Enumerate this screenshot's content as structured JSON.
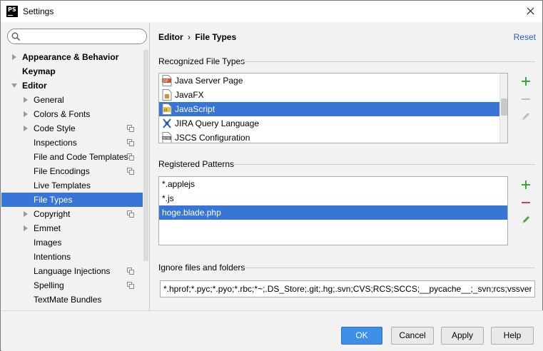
{
  "window": {
    "title": "Settings",
    "app_icon": "PS"
  },
  "search": {
    "placeholder": "",
    "value": ""
  },
  "sidebar": {
    "items": [
      {
        "label": "Appearance & Behavior",
        "level": 0,
        "arrow": "right",
        "bold": true
      },
      {
        "label": "Keymap",
        "level": 0,
        "arrow": "none",
        "bold": true
      },
      {
        "label": "Editor",
        "level": 0,
        "arrow": "down",
        "bold": true
      },
      {
        "label": "General",
        "level": 1,
        "arrow": "right"
      },
      {
        "label": "Colors & Fonts",
        "level": 1,
        "arrow": "right"
      },
      {
        "label": "Code Style",
        "level": 1,
        "arrow": "right",
        "copy": true
      },
      {
        "label": "Inspections",
        "level": 1,
        "arrow": "none",
        "copy": true
      },
      {
        "label": "File and Code Templates",
        "level": 1,
        "arrow": "none",
        "copy": true
      },
      {
        "label": "File Encodings",
        "level": 1,
        "arrow": "none",
        "copy": true
      },
      {
        "label": "Live Templates",
        "level": 1,
        "arrow": "none"
      },
      {
        "label": "File Types",
        "level": 1,
        "arrow": "none",
        "selected": true
      },
      {
        "label": "Copyright",
        "level": 1,
        "arrow": "right",
        "copy": true
      },
      {
        "label": "Emmet",
        "level": 1,
        "arrow": "right"
      },
      {
        "label": "Images",
        "level": 1,
        "arrow": "none"
      },
      {
        "label": "Intentions",
        "level": 1,
        "arrow": "none"
      },
      {
        "label": "Language Injections",
        "level": 1,
        "arrow": "none",
        "copy": true
      },
      {
        "label": "Spelling",
        "level": 1,
        "arrow": "none",
        "copy": true
      },
      {
        "label": "TextMate Bundles",
        "level": 1,
        "arrow": "none"
      }
    ]
  },
  "main": {
    "breadcrumb": {
      "parent": "Editor",
      "separator": "›",
      "current": "File Types"
    },
    "reset_label": "Reset",
    "recognized": {
      "label": "Recognized File Types",
      "items": [
        {
          "label": "Java Server Page",
          "icon": "jsp-file-icon"
        },
        {
          "label": "JavaFX",
          "icon": "javafx-file-icon"
        },
        {
          "label": "JavaScript",
          "icon": "js-file-icon",
          "selected": true
        },
        {
          "label": "JIRA Query Language",
          "icon": "jira-icon"
        },
        {
          "label": "JSCS Configuration",
          "icon": "json-file-icon"
        }
      ]
    },
    "patterns": {
      "label": "Registered Patterns",
      "items": [
        {
          "label": "*.applejs"
        },
        {
          "label": "*.js"
        },
        {
          "label": "hoge.blade.php",
          "selected": true
        }
      ]
    },
    "ignore": {
      "label": "Ignore files and folders",
      "value": "*.hprof;*.pyc;*.pyo;*.rbc;*~;.DS_Store;.git;.hg;.svn;CVS;RCS;SCCS;__pycache__;_svn;rcs;vssver.scc;vs"
    }
  },
  "buttons": {
    "ok": "OK",
    "cancel": "Cancel",
    "apply": "Apply",
    "help": "Help"
  },
  "colors": {
    "selection": "#3875d7",
    "primary_button": "#3d8fe8",
    "link": "#2a5db0",
    "add_green": "#3aa83a",
    "remove_red": "#d04040"
  }
}
